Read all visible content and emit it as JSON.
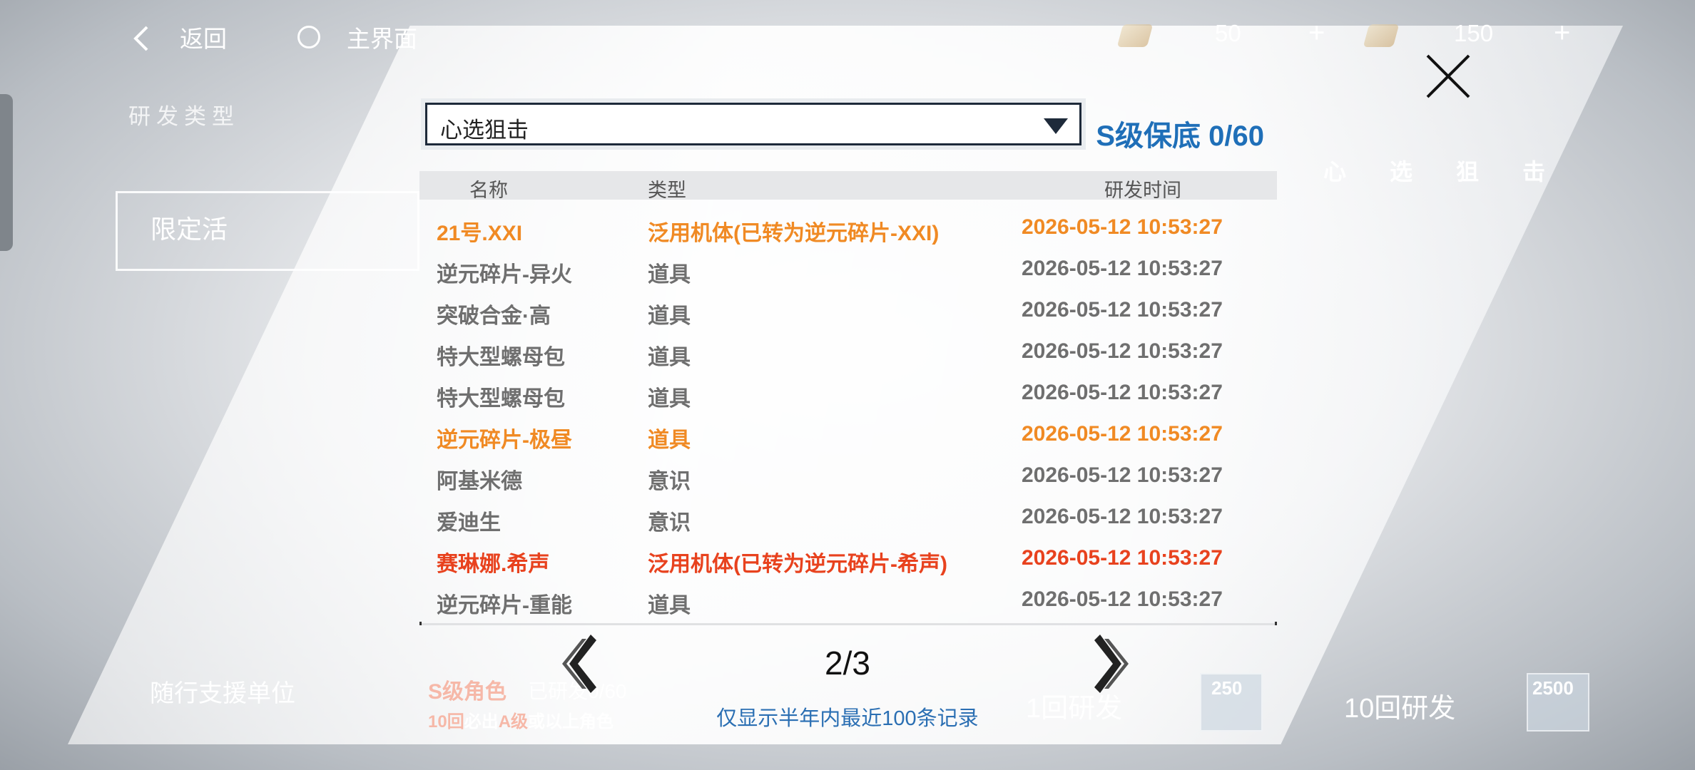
{
  "topbar": {
    "back_label": "返回",
    "home_label": "主界面",
    "resources": [
      {
        "icon": "research-ticket-icon",
        "amount": "50"
      },
      {
        "icon": "black-card-icon",
        "amount": "150"
      }
    ],
    "add_label": "+"
  },
  "background": {
    "research_type_label": "研发类型",
    "limited_label": "限定活",
    "support_unit_label": "随行支援单位",
    "s_pity_label": "S级角色",
    "s_pity_progress": "已研发0/60",
    "guarantee_text": "10回必出A级或以上角色",
    "guarantee_parts": [
      "10回",
      "必出",
      "A级",
      "或以上角色"
    ],
    "right_title_chars": [
      "心",
      "选",
      "狙",
      "击"
    ],
    "once_label": "1回研发",
    "once_cost": "250",
    "ten_label": "10回研发",
    "ten_cost": "2500"
  },
  "modal": {
    "pool_select": "心选狙击",
    "pity_text": "S级保底 0/60",
    "columns": {
      "name": "名称",
      "type": "类型",
      "time": "研发时间"
    },
    "rows": [
      {
        "name": "21号.XXI",
        "type": "泛用机体(已转为逆元碎片-XXI)",
        "time": "2026-05-12 10:53:27",
        "color": "#f08a24"
      },
      {
        "name": "逆元碎片-异火",
        "type": "道具",
        "time": "2026-05-12 10:53:27",
        "color": "#6f6f6f"
      },
      {
        "name": "突破合金·高",
        "type": "道具",
        "time": "2026-05-12 10:53:27",
        "color": "#6f6f6f"
      },
      {
        "name": "特大型螺母包",
        "type": "道具",
        "time": "2026-05-12 10:53:27",
        "color": "#6f6f6f"
      },
      {
        "name": "特大型螺母包",
        "type": "道具",
        "time": "2026-05-12 10:53:27",
        "color": "#6f6f6f"
      },
      {
        "name": "逆元碎片-极昼",
        "type": "道具",
        "time": "2026-05-12 10:53:27",
        "color": "#f08a24"
      },
      {
        "name": "阿基米德",
        "type": "意识",
        "time": "2026-05-12 10:53:27",
        "color": "#6f6f6f"
      },
      {
        "name": "爱迪生",
        "type": "意识",
        "time": "2026-05-12 10:53:27",
        "color": "#6f6f6f"
      },
      {
        "name": "赛琳娜.希声",
        "type": "泛用机体(已转为逆元碎片-希声)",
        "time": "2026-05-12 10:53:27",
        "color": "#e8421e"
      },
      {
        "name": "逆元碎片-重能",
        "type": "道具",
        "time": "2026-05-12 10:53:27",
        "color": "#6f6f6f"
      }
    ],
    "page": "2/3",
    "footnote": "仅显示半年内最近100条记录"
  }
}
